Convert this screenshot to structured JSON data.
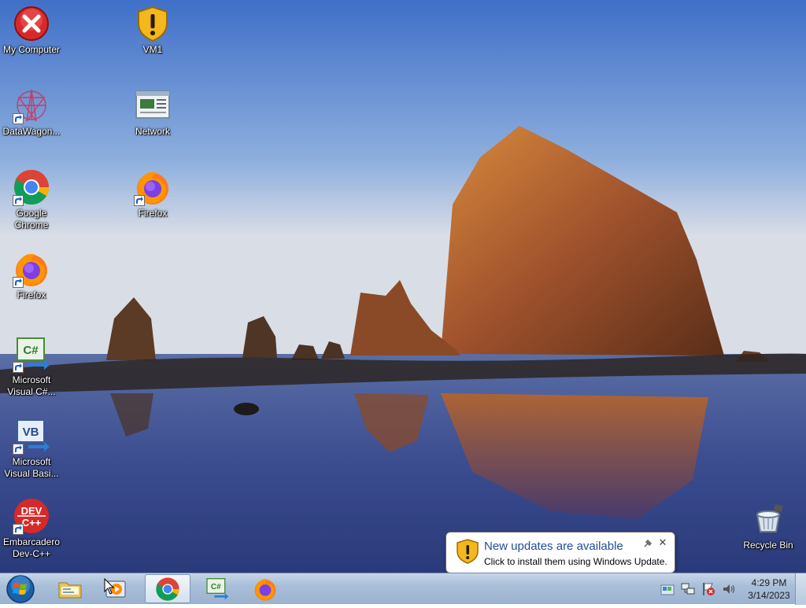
{
  "desktop": {
    "icons": [
      {
        "id": "my-computer",
        "label": "My Computer",
        "icon": "error-x-icon"
      },
      {
        "id": "vm1",
        "label": "VM1",
        "icon": "security-shield-icon"
      },
      {
        "id": "datawagon",
        "label": "DataWagon...",
        "icon": "datawagon-icon"
      },
      {
        "id": "network",
        "label": "Network",
        "icon": "network-icon"
      },
      {
        "id": "google-chrome",
        "label": "Google\nChrome",
        "icon": "chrome-icon"
      },
      {
        "id": "firefox-2",
        "label": "Firefox",
        "icon": "firefox-icon"
      },
      {
        "id": "firefox-1",
        "label": "Firefox",
        "icon": "firefox-icon"
      },
      {
        "id": "visual-csharp",
        "label": "Microsoft\nVisual C#...",
        "icon": "visual-csharp-icon"
      },
      {
        "id": "visual-basic",
        "label": "Microsoft\nVisual Basi...",
        "icon": "visual-basic-icon"
      },
      {
        "id": "devcpp",
        "label": "Embarcadero\nDev-C++",
        "icon": "devcpp-icon"
      },
      {
        "id": "recycle-bin",
        "label": "Recycle Bin",
        "icon": "recycle-bin-icon"
      }
    ]
  },
  "balloon": {
    "title": "New updates are available",
    "text": "Click to install them using Windows Update."
  },
  "taskbar": {
    "buttons": [
      {
        "name": "file-explorer",
        "icon": "folder-icon"
      },
      {
        "name": "media-player",
        "icon": "media-player-icon"
      },
      {
        "name": "chrome",
        "icon": "chrome-icon",
        "active": true
      },
      {
        "name": "visual-csharp",
        "icon": "visual-csharp-icon"
      },
      {
        "name": "firefox",
        "icon": "firefox-icon"
      }
    ],
    "clock": {
      "time": "4:29 PM",
      "date": "3/14/2023"
    }
  },
  "colors": {
    "sky_top": "#3f6fc8",
    "sky_bottom": "#d9dde6",
    "rock": "#a0522d",
    "balloon_title": "#1e4e9a"
  }
}
